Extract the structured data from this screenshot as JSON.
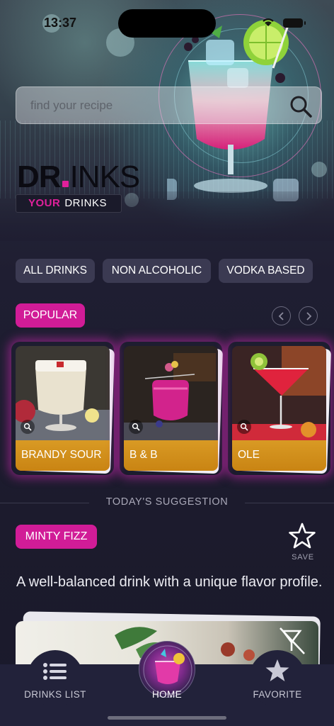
{
  "status_bar": {
    "time": "13:37"
  },
  "search": {
    "placeholder": "find your recipe"
  },
  "brand": {
    "logo_left": "DR",
    "logo_right": "INKS",
    "tagline_your": "YOUR",
    "tagline_drinks": "DRINKS"
  },
  "filters": [
    "ALL DRINKS",
    "NON ALCOHOLIC",
    "VODKA BASED"
  ],
  "popular": {
    "label": "POPULAR",
    "cards": [
      {
        "name": "BRANDY SOUR"
      },
      {
        "name": "B & B"
      },
      {
        "name": "OLE"
      }
    ]
  },
  "suggestion": {
    "section_title": "TODAY'S SUGGESTION",
    "drink_name": "MINTY FIZZ",
    "save_label": "SAVE",
    "description": "A well-balanced drink with a unique flavor profile."
  },
  "tabbar": {
    "tabs": [
      {
        "label": "DRINKS LIST",
        "icon": "list-icon"
      },
      {
        "label": "HOME",
        "icon": "cocktail-home-icon"
      },
      {
        "label": "FAVORITE",
        "icon": "star-icon"
      }
    ]
  },
  "colors": {
    "accent": "#d11c97",
    "card_label": "#d08d1c",
    "background": "#1c1b2d"
  }
}
